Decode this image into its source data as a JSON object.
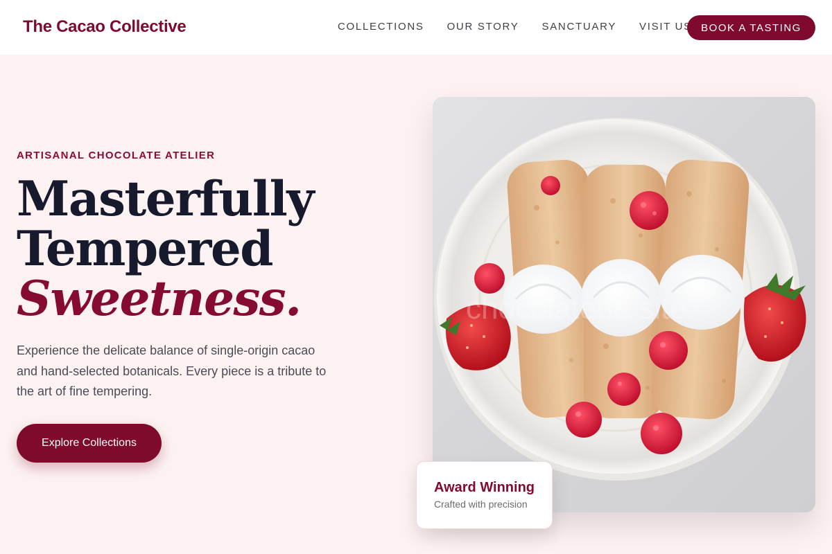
{
  "header": {
    "brand": "The Cacao Collective",
    "nav": [
      "COLLECTIONS",
      "OUR STORY",
      "SANCTUARY",
      "VISIT US"
    ],
    "cta": "BOOK A TASTING"
  },
  "hero": {
    "eyebrow": "ARTISANAL CHOCOLATE ATELIER",
    "headline_line1": "Masterfully",
    "headline_line2": "Tempered",
    "headline_accent": "Sweetness.",
    "description": "Experience the delicate balance of single-origin cacao and hand-selected botanicals. Every piece is a tribute to the art of fine tempering.",
    "button": "Explore Collections",
    "image_icon": "crepes-with-berries-photo",
    "watermark": "chocolaterie site"
  },
  "award": {
    "title": "Award Winning",
    "subtitle": "Crafted with precision"
  },
  "colors": {
    "brand": "#800a2e",
    "background": "#fdf2f2",
    "heading": "#171a2c",
    "body_text": "#4b4b55"
  }
}
